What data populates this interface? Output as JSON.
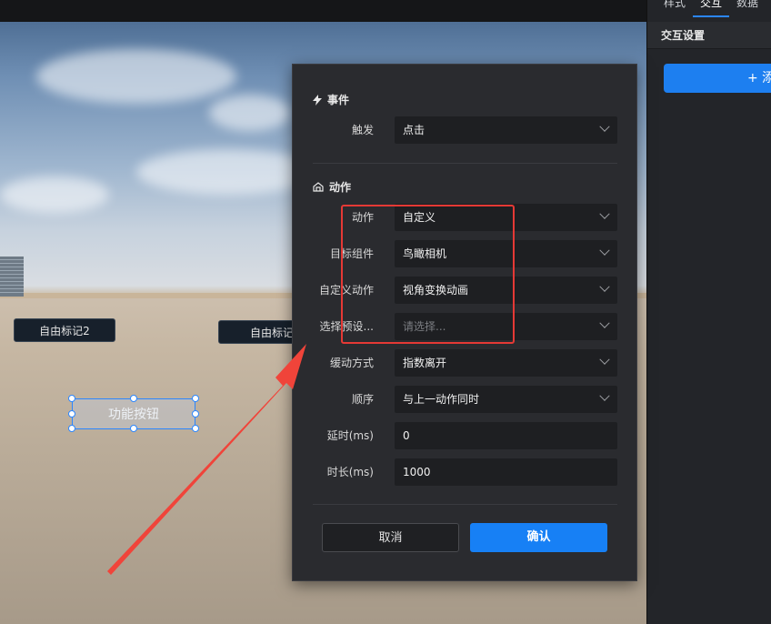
{
  "right_panel": {
    "tabs": [
      "样式",
      "交互",
      "数据"
    ],
    "active_tab": "交互",
    "section_title": "交互设置",
    "add_button_label": "+ 添"
  },
  "scene": {
    "markers": [
      "自由标记2",
      "自由标记"
    ],
    "function_button_label": "功能按钮"
  },
  "dialog": {
    "event_section": {
      "title": "事件",
      "icon": "lightning-icon"
    },
    "trigger": {
      "label": "触发",
      "value": "点击"
    },
    "action_section": {
      "title": "动作",
      "icon": "action-icon"
    },
    "fields": [
      {
        "label": "动作",
        "value": "自定义",
        "placeholder": false
      },
      {
        "label": "目标组件",
        "value": "鸟瞰相机",
        "placeholder": false
      },
      {
        "label": "自定义动作",
        "value": "视角变换动画",
        "placeholder": false
      },
      {
        "label": "选择预设...",
        "value": "请选择...",
        "placeholder": true
      },
      {
        "label": "缓动方式",
        "value": "指数离开",
        "placeholder": false
      },
      {
        "label": "顺序",
        "value": "与上一动作同时",
        "placeholder": false
      }
    ],
    "inputs": [
      {
        "label": "延时(ms)",
        "value": "0"
      },
      {
        "label": "时长(ms)",
        "value": "1000"
      }
    ],
    "cancel_label": "取消",
    "confirm_label": "确认"
  },
  "colors": {
    "accent": "#1780f5",
    "highlight": "#e53935",
    "dialog_bg": "#2a2b2f",
    "field_bg": "#1e1f22"
  }
}
